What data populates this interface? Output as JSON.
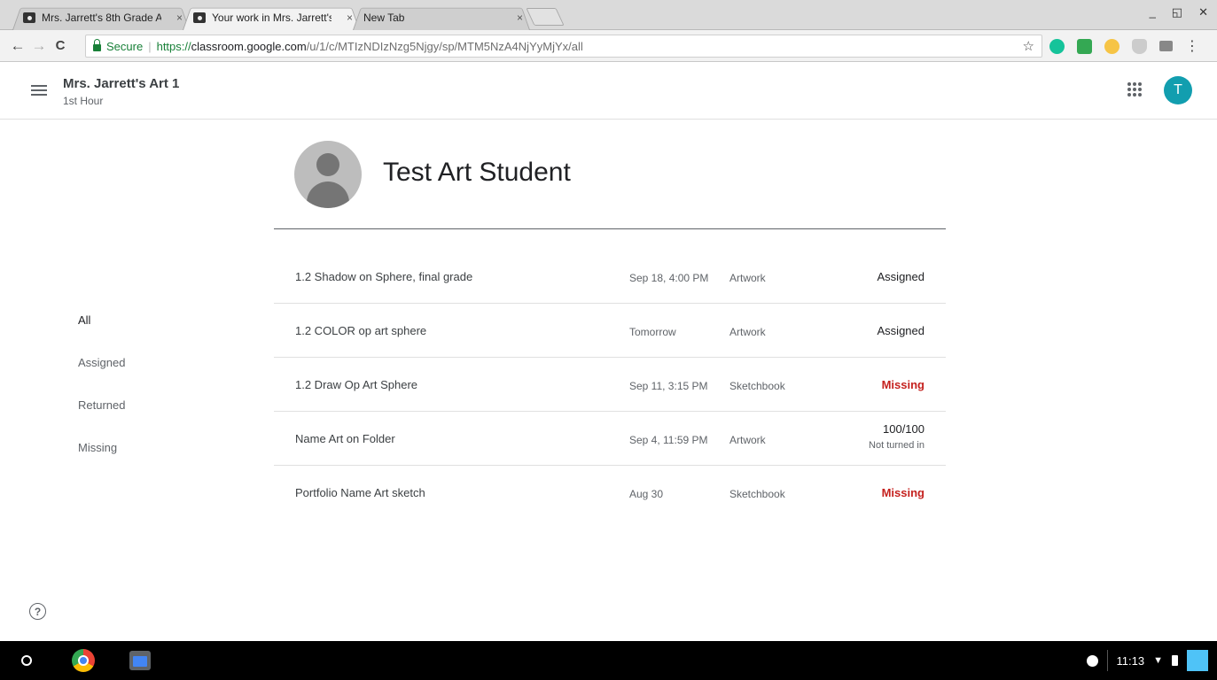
{
  "browser": {
    "tabs": [
      {
        "title": "Mrs. Jarrett's 8th Grade A",
        "active": false
      },
      {
        "title": "Your work in Mrs. Jarrett's",
        "active": true
      },
      {
        "title": "New Tab",
        "active": false
      }
    ],
    "close_glyph": "×",
    "window_controls": {
      "minimize": "_",
      "restore": "◱",
      "close": "✕"
    },
    "nav": {
      "back": "←",
      "forward": "→",
      "reload": "C"
    },
    "omnibox": {
      "secure_label": "Secure",
      "separator": "|",
      "url_scheme": "https://",
      "url_host": "classroom.google.com",
      "url_path": "/u/1/c/MTIzNDIzNzg5Njgy/sp/MTM5NzA4NjYyMjYx/all",
      "star": "☆"
    },
    "menu": "⋮"
  },
  "header": {
    "class_title": "Mrs. Jarrett's Art 1",
    "class_section": "1st Hour",
    "avatar_initial": "T"
  },
  "filters": [
    {
      "label": "All",
      "active": true
    },
    {
      "label": "Assigned",
      "active": false
    },
    {
      "label": "Returned",
      "active": false
    },
    {
      "label": "Missing",
      "active": false
    }
  ],
  "student": {
    "name": "Test Art Student"
  },
  "work_items": [
    {
      "title": "1.2 Shadow on Sphere, final grade",
      "due": "Sep 18, 4:00 PM",
      "topic": "Artwork",
      "status": "Assigned",
      "status_type": "assigned",
      "sub": ""
    },
    {
      "title": "1.2 COLOR op art sphere",
      "due": "Tomorrow",
      "topic": "Artwork",
      "status": "Assigned",
      "status_type": "assigned",
      "sub": ""
    },
    {
      "title": "1.2 Draw Op Art Sphere",
      "due": "Sep 11, 3:15 PM",
      "topic": "Sketchbook",
      "status": "Missing",
      "status_type": "missing",
      "sub": ""
    },
    {
      "title": "Name Art on Folder",
      "due": "Sep 4, 11:59 PM",
      "topic": "Artwork",
      "status": "100/100",
      "status_type": "graded",
      "sub": "Not turned in"
    },
    {
      "title": "Portfolio Name Art sketch",
      "due": "Aug 30",
      "topic": "Sketchbook",
      "status": "Missing",
      "status_type": "missing",
      "sub": ""
    }
  ],
  "help": "?",
  "shelf": {
    "time": "11:13",
    "wifi": "▼"
  },
  "colors": {
    "missing": "#c5221f",
    "secure": "#188038",
    "avatar": "#129eaf"
  }
}
